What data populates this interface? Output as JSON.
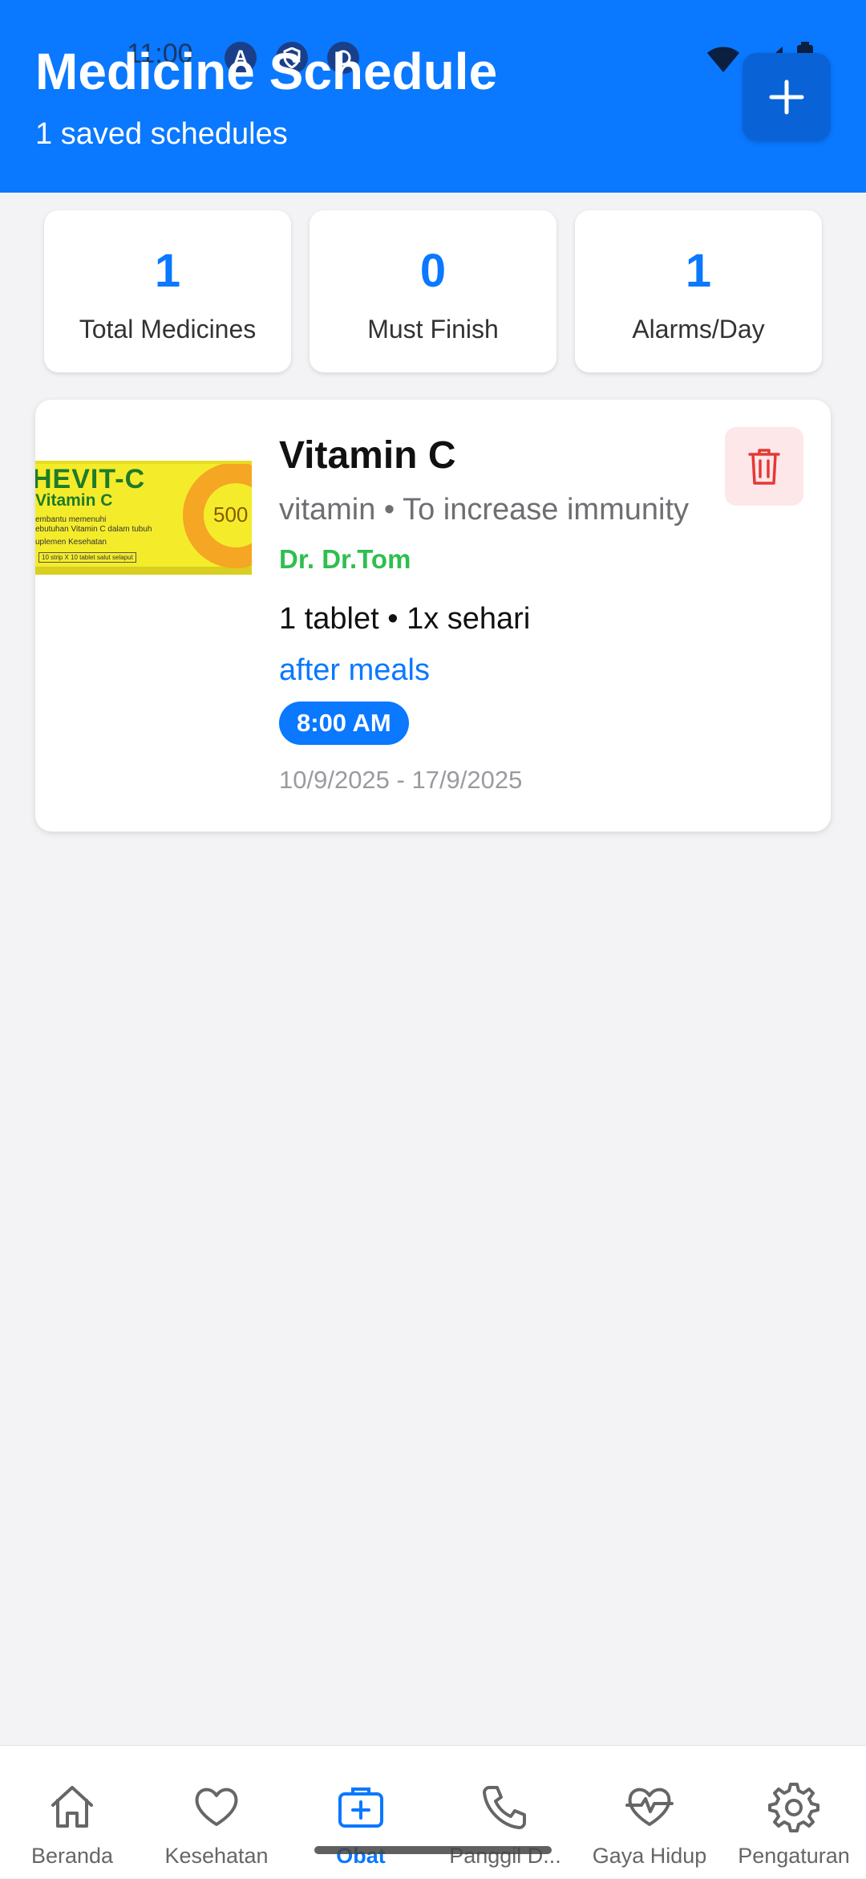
{
  "status_bar": {
    "time": "11:00"
  },
  "header": {
    "title": "Medicine Schedule",
    "subtitle": "1 saved schedules",
    "accent_color": "#0a78ff",
    "add_icon": "plus-icon"
  },
  "stats": [
    {
      "value": "1",
      "label": "Total Medicines"
    },
    {
      "value": "0",
      "label": "Must Finish"
    },
    {
      "value": "1",
      "label": "Alarms/Day"
    }
  ],
  "medicine": {
    "name": "Vitamin C",
    "type_purpose": "vitamin • To increase immunity",
    "doctor": "Dr. Dr.Tom",
    "dose": "1 tablet • 1x sehari",
    "timing": "after meals",
    "time": "8:00 AM",
    "dates": "10/9/2025 - 17/9/2025",
    "image_text": {
      "brand": "HEVIT-C",
      "product": "Vitamin C",
      "line1": "embantu memenuhi",
      "line2": "ebutuhan Vitamin C dalam tubuh",
      "line3": "uplemen Kesehatan",
      "strip": "10 strip X 10 tablet salut selaput",
      "dose_mark": "500"
    },
    "delete_icon": "trash-icon"
  },
  "nav": [
    {
      "label": "Beranda",
      "icon": "home-icon"
    },
    {
      "label": "Kesehatan",
      "icon": "heart-icon"
    },
    {
      "label": "Obat",
      "icon": "medical-kit-icon"
    },
    {
      "label": "Panggil D...",
      "icon": "phone-icon"
    },
    {
      "label": "Gaya Hidup",
      "icon": "heart-pulse-icon"
    },
    {
      "label": "Pengaturan",
      "icon": "gear-icon"
    }
  ]
}
